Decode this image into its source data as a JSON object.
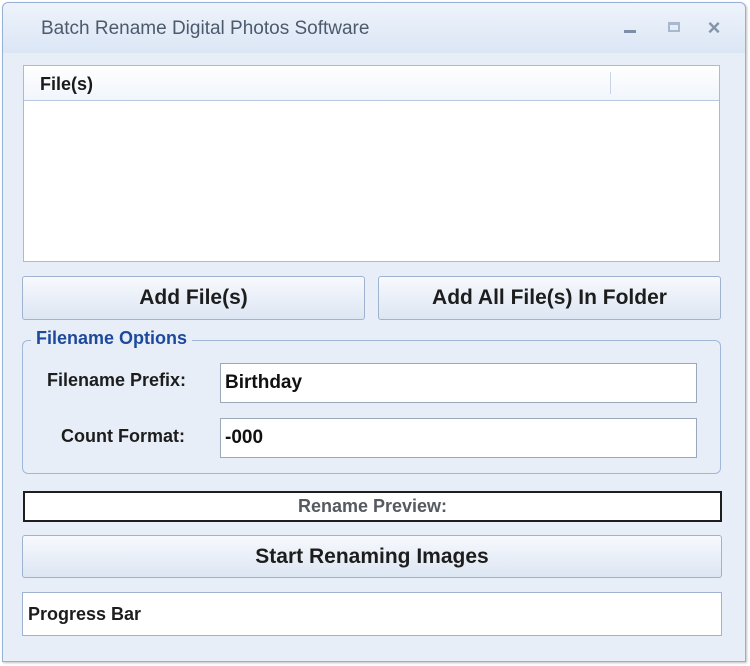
{
  "window": {
    "title": "Batch Rename Digital Photos Software",
    "controls": {
      "minimize": "minimize-icon",
      "maximize": "maximize-icon",
      "close": "×"
    }
  },
  "file_list": {
    "columns": [
      "File(s)"
    ],
    "rows": []
  },
  "buttons": {
    "add_files": "Add File(s)",
    "add_folder": "Add All File(s) In Folder",
    "start": "Start Renaming Images"
  },
  "filename_options": {
    "legend": "Filename Options",
    "prefix_label": "Filename Prefix:",
    "prefix_value": "Birthday",
    "count_label": "Count Format:",
    "count_value": "-000"
  },
  "preview": {
    "label": "Rename Preview:"
  },
  "progress": {
    "label": "Progress Bar"
  },
  "colors": {
    "window_bg": "#e8eef8",
    "accent": "#1d4a9c",
    "border": "#9fb3d1"
  }
}
